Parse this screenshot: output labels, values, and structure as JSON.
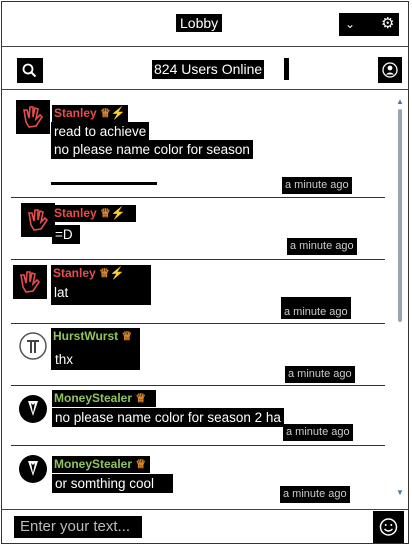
{
  "header": {
    "title": "Lobby",
    "icons": {
      "dropdown": "chevron-down-icon",
      "settings": "gear-icon"
    }
  },
  "toolbar": {
    "online_text": "824 Users Online",
    "search_icon": "search-icon",
    "profile_icon": "user-icon"
  },
  "messages": [
    {
      "user": "Stanley",
      "user_color": "#e84c4c",
      "lines": [
        "read to achieve",
        "no please name color for season"
      ],
      "time": "a minute ago"
    },
    {
      "user": "Stanley",
      "user_color": "#e84c4c",
      "lines": [
        "=D"
      ],
      "time": "a minute ago"
    },
    {
      "user": "Stanley",
      "user_color": "#e84c4c",
      "lines": [
        "lat"
      ],
      "time": "a minute ago"
    },
    {
      "user": "HurstWurst",
      "user_color": "#8fc35c",
      "lines": [
        "thx"
      ],
      "time": "a minute ago"
    },
    {
      "user": "MoneyStealer",
      "user_color": "#8fc35c",
      "lines": [
        "no please name color for season 2 ha"
      ],
      "time": "a minute ago"
    },
    {
      "user": "MoneyStealer",
      "user_color": "#8fc35c",
      "lines": [
        "or somthing cool"
      ],
      "time": "a minute ago"
    }
  ],
  "composer": {
    "placeholder": "Enter your text...",
    "emoji_icon": "smiley-icon"
  },
  "colors": {
    "scroll_accent": "#4a78a8",
    "badge": "#e08a2a",
    "bolt": "#ffcc33"
  }
}
